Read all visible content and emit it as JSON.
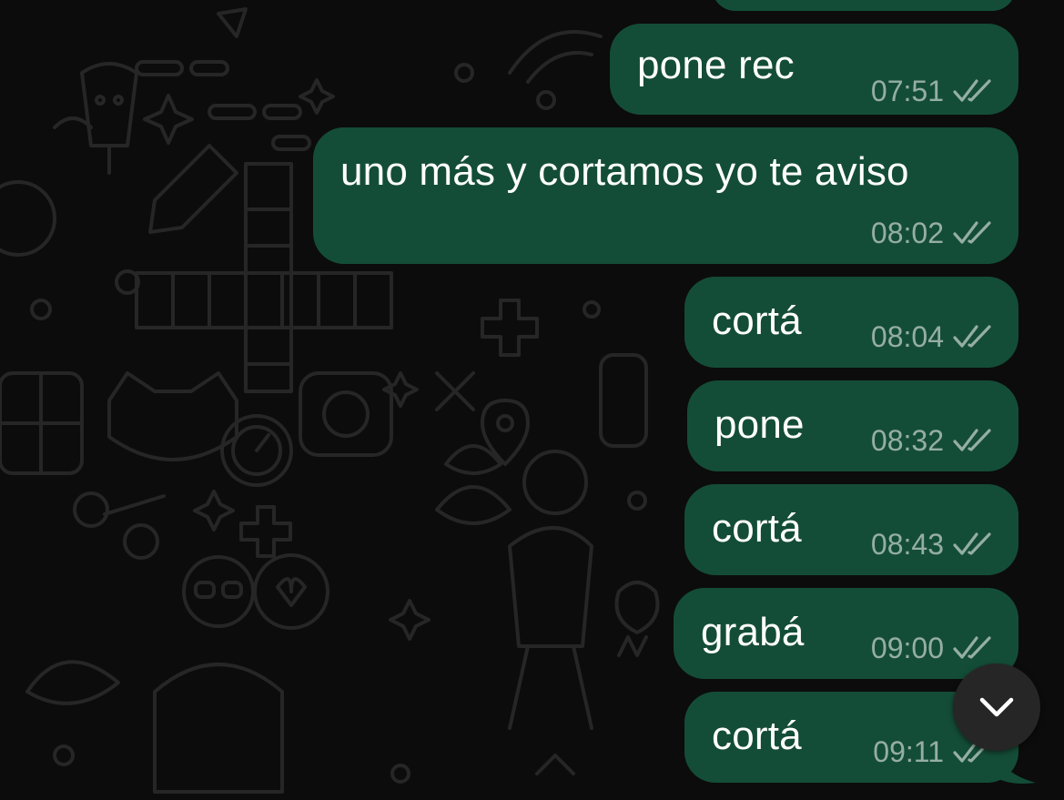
{
  "messages": [
    {
      "text": "pone rec",
      "time": "07:51",
      "status": "read"
    },
    {
      "text": "uno más y cortamos yo te aviso",
      "time": "08:02",
      "status": "read"
    },
    {
      "text": "cortá",
      "time": "08:04",
      "status": "read"
    },
    {
      "text": "pone",
      "time": "08:32",
      "status": "read"
    },
    {
      "text": "cortá",
      "time": "08:43",
      "status": "read"
    },
    {
      "text": "grabá",
      "time": "09:00",
      "status": "read"
    },
    {
      "text": "cortá",
      "time": "09:11",
      "status": "read"
    }
  ],
  "icons": {
    "ticks": "double-check-icon",
    "scroll": "chevron-down-icon"
  },
  "colors": {
    "background": "#0c0c0c",
    "outgoing_bubble": "#144d37",
    "text": "#ffffff",
    "meta": "#a0b5ab",
    "scroll_button": "#262626",
    "doodle": "#2a2a2a"
  }
}
